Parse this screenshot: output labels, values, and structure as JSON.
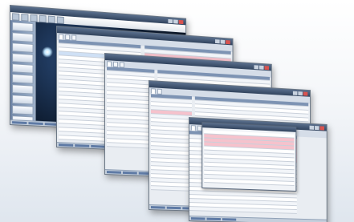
{
  "windows": [
    {
      "title": "",
      "tabs": [
        "",
        "",
        "",
        ""
      ]
    },
    {
      "title": "",
      "tabs": [
        "",
        "",
        ""
      ]
    },
    {
      "title": "",
      "tabs": [
        "",
        "",
        ""
      ]
    },
    {
      "title": "",
      "tabs": [
        "",
        ""
      ]
    },
    {
      "title": "",
      "tabs": [
        "",
        ""
      ]
    }
  ],
  "colors": {
    "titlebar": "#32445e",
    "highlight_pink": "#f6c2cc",
    "highlight_green": "#bfe3b8",
    "accent_blue": "#5e7aa5"
  },
  "icons": [
    "minimize-icon",
    "maximize-icon",
    "close-icon",
    "light-glow-icon"
  ]
}
